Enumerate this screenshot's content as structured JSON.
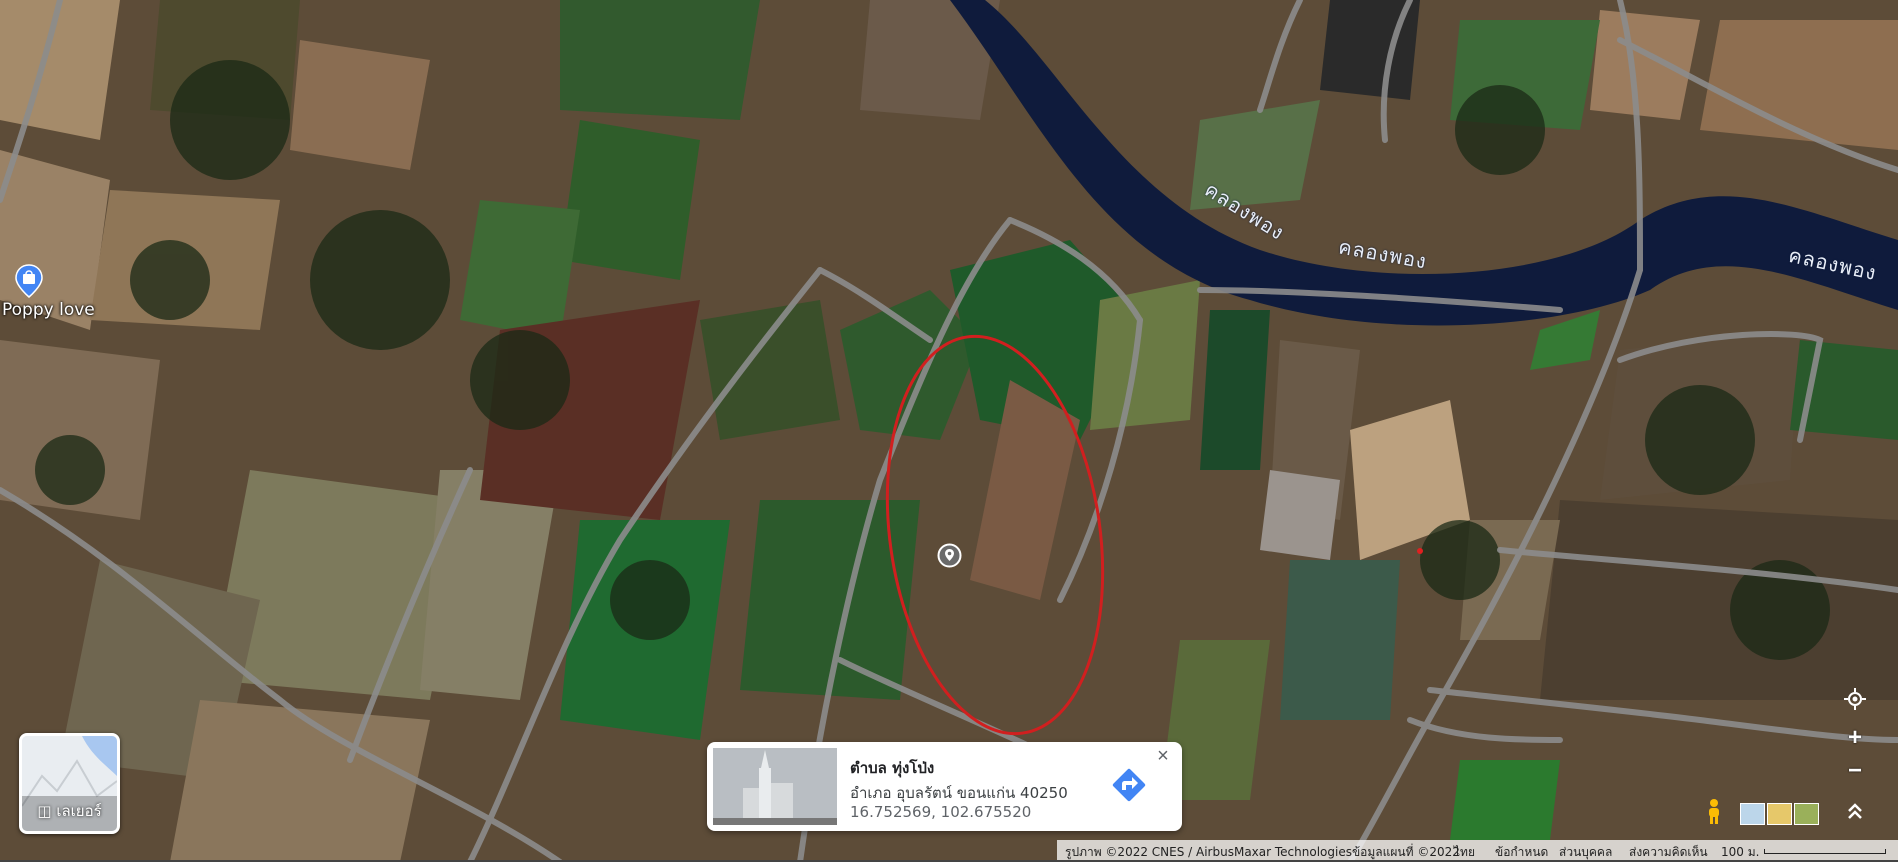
{
  "map": {
    "poi": {
      "name": "Poppy love",
      "icon": "shopping-bag-pin-icon"
    },
    "river_labels": [
      "คลองพอง",
      "คลองพอง",
      "คลองพอง"
    ],
    "selection_marker_icon": "map-pin-icon"
  },
  "layers": {
    "label": "เลเยอร์",
    "icon": "layers-icon"
  },
  "info_card": {
    "title": "ตำบล ทุ่งโป่ง",
    "address": "อำเภอ อุบลรัตน์ ขอนแก่น 40250",
    "coordinates": "16.752569, 102.675520",
    "close": "×",
    "directions_icon": "directions-icon"
  },
  "controls": {
    "locate_icon": "my-location-icon",
    "zoom_in": "+",
    "zoom_out": "−",
    "pegman_icon": "pegman-icon",
    "expand_icon": "chevron-up-icon"
  },
  "footer": {
    "attribution": "รูปภาพ ©2022 CNES / AirbusMaxar Technologiesข้อมูลแผนที่ ©2022",
    "language": "ไทย",
    "terms": "ข้อกำหนด",
    "privacy": "ส่วนบุคคล",
    "feedback": "ส่งความคิดเห็น",
    "scale": "100 ม."
  },
  "colors": {
    "river": "#0f1b3c",
    "road": "#8c8c8c",
    "selection_ring": "#d11f1f",
    "directions": "#4285f4"
  }
}
